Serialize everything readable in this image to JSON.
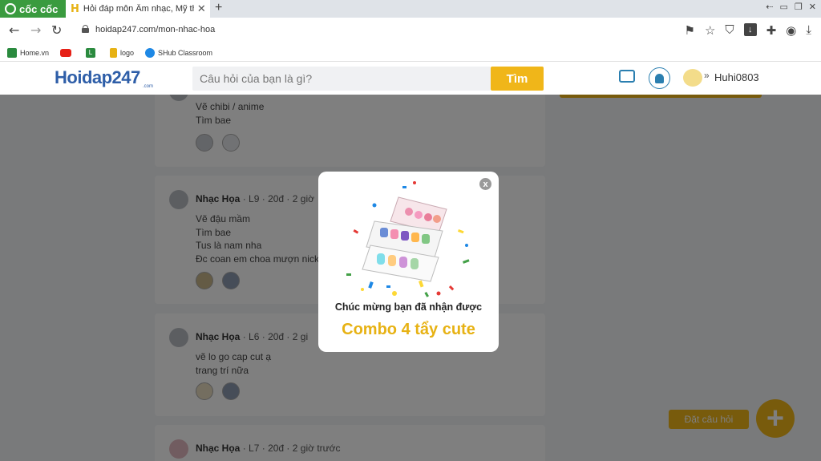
{
  "browser": {
    "brand": "cốc cốc",
    "tab_title": "Hỏi đáp môn Âm nhạc, Mỹ th",
    "url": "hoidap247.com/mon-nhac-hoa",
    "bookmarks": [
      "Home.vn",
      "logo",
      "SHub Classroom"
    ],
    "bookmark_letter": "L"
  },
  "header": {
    "logo": "Hoidap247",
    "logo_sub": ".com",
    "search_placeholder": "Câu hỏi của bạn là gì?",
    "search_button": "Tìm",
    "username": "Huhi0803"
  },
  "posts": [
    {
      "author": "",
      "level": "",
      "points": "",
      "time": "",
      "lines": [
        "Vẽ chibi / anime",
        "Tìm bae"
      ]
    },
    {
      "author": "Nhạc Họa",
      "level": "L9",
      "points": "20đ",
      "time": "2 giờ",
      "lines": [
        "Vẽ đậu mầm",
        "Tìm bae",
        "Tus là nam nha",
        "Đc coan em choa mượn nick"
      ]
    },
    {
      "author": "Nhạc Họa",
      "level": "L6",
      "points": "20đ",
      "time": "2 gi",
      "lines": [
        "vẽ  lo go cap cut ạ",
        "trang trí nữa"
      ]
    },
    {
      "author": "Nhạc Họa",
      "level": "L7",
      "points": "20đ",
      "time": "2 giờ trước",
      "lines": []
    }
  ],
  "float_action": {
    "label": "Đặt câu hỏi",
    "icon": "plus-icon"
  },
  "modal": {
    "close": "x",
    "title": "Chúc mừng bạn đã nhận được",
    "prize": "Combo 4 tẩy cute"
  },
  "colors": {
    "accent": "#f0b619",
    "brand_blue": "#2e5ea8",
    "coccoc_green": "#3a9b3f"
  }
}
